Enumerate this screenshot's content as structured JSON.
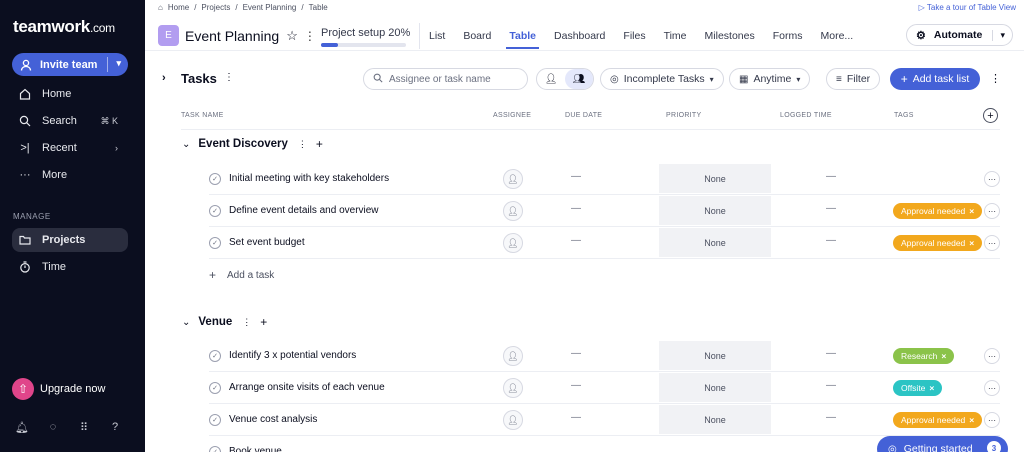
{
  "sidebar": {
    "logo": "teamwork",
    "logo_suffix": ".com",
    "invite_label": "Invite team",
    "nav": [
      {
        "label": "Home",
        "icon": "home-icon"
      },
      {
        "label": "Search",
        "icon": "search-icon",
        "shortcut": "⌘ K"
      },
      {
        "label": "Recent",
        "icon": "recent-icon"
      },
      {
        "label": "More",
        "icon": "more-icon"
      }
    ],
    "manage_label": "MANAGE",
    "manage_items": [
      {
        "label": "Projects",
        "icon": "folder-icon",
        "active": true
      },
      {
        "label": "Time",
        "icon": "timer-icon"
      }
    ],
    "upgrade_label": "Upgrade now"
  },
  "breadcrumb": [
    "Home",
    "Projects",
    "Event Planning",
    "Table"
  ],
  "tour_label": "Take a tour of Table View",
  "project": {
    "badge": "E",
    "title": "Event Planning",
    "setup_label": "Project setup 20%",
    "setup_progress": 0.2
  },
  "tabs": [
    "List",
    "Board",
    "Table",
    "Dashboard",
    "Files",
    "Time",
    "Milestones",
    "Forms",
    "More..."
  ],
  "active_tab": "Table",
  "automate_label": "Automate",
  "toolbar": {
    "title": "Tasks",
    "search_placeholder": "Assignee or task name",
    "filter_incomplete": "Incomplete Tasks",
    "filter_date": "Anytime",
    "filter_label": "Filter",
    "add_list_label": "Add task list"
  },
  "columns": [
    "TASK NAME",
    "ASSIGNEE",
    "DUE DATE",
    "PRIORITY",
    "LOGGED TIME",
    "TAGS"
  ],
  "groups": [
    {
      "name": "Event Discovery",
      "tasks": [
        {
          "name": "Initial meeting with key stakeholders",
          "due": "—",
          "priority": "None",
          "logged": "—",
          "tag": ""
        },
        {
          "name": "Define event details and overview",
          "due": "—",
          "priority": "None",
          "logged": "—",
          "tag": "Approval needed"
        },
        {
          "name": "Set event budget",
          "due": "—",
          "priority": "None",
          "logged": "—",
          "tag": "Approval needed"
        }
      ],
      "add_task_label": "Add a task"
    },
    {
      "name": "Venue",
      "tasks": [
        {
          "name": "Identify 3 x potential vendors",
          "due": "—",
          "priority": "None",
          "logged": "—",
          "tag": "Research"
        },
        {
          "name": "Arrange onsite visits of each venue",
          "due": "—",
          "priority": "None",
          "logged": "—",
          "tag": "Offsite"
        },
        {
          "name": "Venue cost analysis",
          "due": "—",
          "priority": "None",
          "logged": "—",
          "tag": "Approval needed"
        },
        {
          "name": "Book venue",
          "due": "",
          "priority": "",
          "logged": "",
          "tag": ""
        }
      ]
    }
  ],
  "tag_colors": {
    "Approval needed": "#f2a81d",
    "Research": "#8bc34a",
    "Offsite": "#2bc4c4"
  },
  "getting_started": {
    "label": "Getting started",
    "count": "3"
  },
  "colors": {
    "accent": "#4461d7",
    "sidebar_bg": "#0b0e1f",
    "upgrade": "#e0458a"
  }
}
